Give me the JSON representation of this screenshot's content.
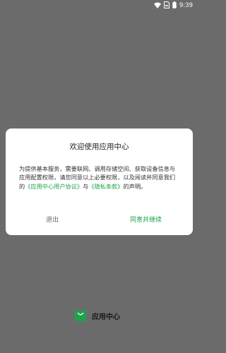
{
  "status_bar": {
    "time": "9:39"
  },
  "dialog": {
    "title": "欢迎使用应用中心",
    "body": {
      "text_1": "为提供基本服务，需要联网、调用存储空间、获取设备信息与应用配置权限，请您同意以上必要权限，以及阅读并同意我们的",
      "user_agreement_link": "《应用中心用户协议》",
      "text_2": "与",
      "privacy_link": "《隐私条款》",
      "text_3": "的声明。"
    },
    "exit_label": "退出",
    "agree_label": "同意并继续"
  },
  "brand": {
    "name": "应用中心"
  },
  "colors": {
    "accent": "#1ba34b",
    "background": "#6b6b6b"
  },
  "icons": {
    "wifi": "wifi-icon",
    "sim": "sim-card-icon",
    "battery": "battery-icon",
    "logo": "shopping-bag-icon"
  }
}
